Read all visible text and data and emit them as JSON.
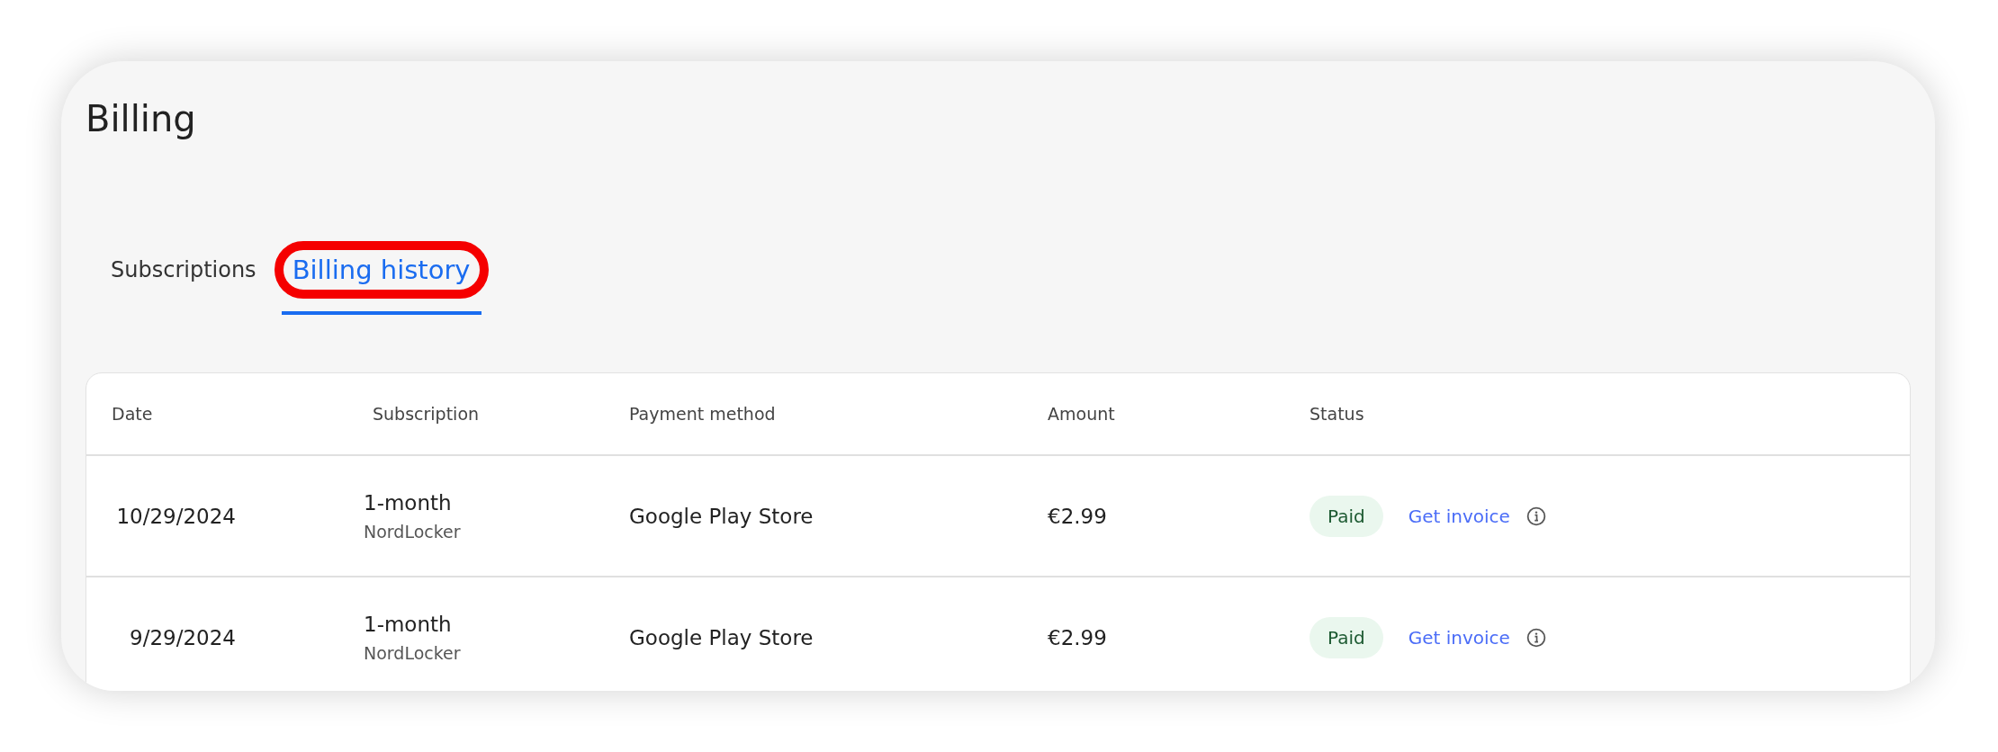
{
  "page": {
    "title": "Billing"
  },
  "tabs": [
    {
      "label": "Subscriptions",
      "selected": false,
      "highlighted": false
    },
    {
      "label": "Billing history",
      "selected": true,
      "highlighted": true
    }
  ],
  "table": {
    "columns": [
      "Date",
      "Subscription",
      "Payment method",
      "Amount",
      "Status"
    ],
    "rows": [
      {
        "date": "10/29/2024",
        "plan": "1-month",
        "product": "NordLocker",
        "payment_method": "Google Play Store",
        "amount": "€2.99",
        "status": "Paid",
        "action": "Get invoice"
      },
      {
        "date": "9/29/2024",
        "plan": "1-month",
        "product": "NordLocker",
        "payment_method": "Google Play Store",
        "amount": "€2.99",
        "status": "Paid",
        "action": "Get invoice"
      }
    ]
  }
}
